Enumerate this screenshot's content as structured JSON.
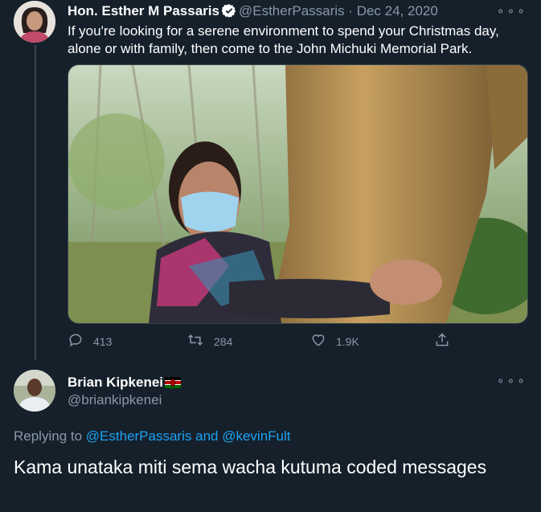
{
  "tweet": {
    "author_name": "Hon. Esther M Passaris",
    "author_handle": "@EstherPassaris",
    "separator": "·",
    "date": "Dec 24, 2020",
    "more": "⚬⚬⚬",
    "text": "If you're looking for a serene environment to spend your Christmas day, alone or with family, then come to the John Michuki Memorial Park.",
    "actions": {
      "replies": "413",
      "retweets": "284",
      "likes": "1.9K"
    }
  },
  "reply": {
    "author_name": "Brian Kipkenei",
    "author_handle": "@briankipkenei",
    "more": "⚬⚬⚬",
    "replying_prefix": "Replying to",
    "replying_user1": "@EstherPassaris",
    "replying_and": "and",
    "replying_user2": "@kevinFult",
    "text": "Kama unataka miti sema wacha kutuma coded messages"
  },
  "colors": {
    "background": "#15202b",
    "secondary_text": "#8899a6",
    "link": "#1da1f2",
    "verified": "#ffffff"
  }
}
